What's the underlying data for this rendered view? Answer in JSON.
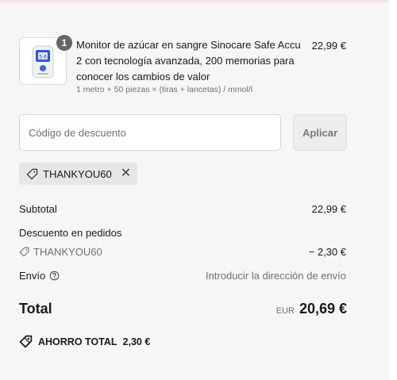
{
  "product": {
    "quantity": "1",
    "title": "Monitor de azúcar en sangre Sinocare Safe Accu 2 con tecnología avanzada, 200 memorias para conocer los cambios de valor",
    "variant": "1 metro + 50 piezas × (tiras + lancetas) / mmol/l",
    "price": "22,99 €",
    "image_icon": "glucose-meter-icon"
  },
  "discount": {
    "placeholder": "Código de descuento",
    "apply_label": "Aplicar",
    "applied_code": "THANKYOU60"
  },
  "summary": {
    "subtotal_label": "Subtotal",
    "subtotal_value": "22,99 €",
    "order_discount_label": "Descuento en pedidos",
    "order_discount_code": "THANKYOU60",
    "order_discount_value": "− 2,30 €",
    "shipping_label": "Envío",
    "shipping_value": "Introducir la dirección de envío",
    "total_label": "Total",
    "currency": "EUR",
    "total_value": "20,69 €",
    "savings_label": "AHORRO TOTAL",
    "savings_value": "2,30 €"
  },
  "colors": {
    "background": "#f6f6f6",
    "badge": "#666666",
    "meter_screen": "#2a5bd7"
  }
}
